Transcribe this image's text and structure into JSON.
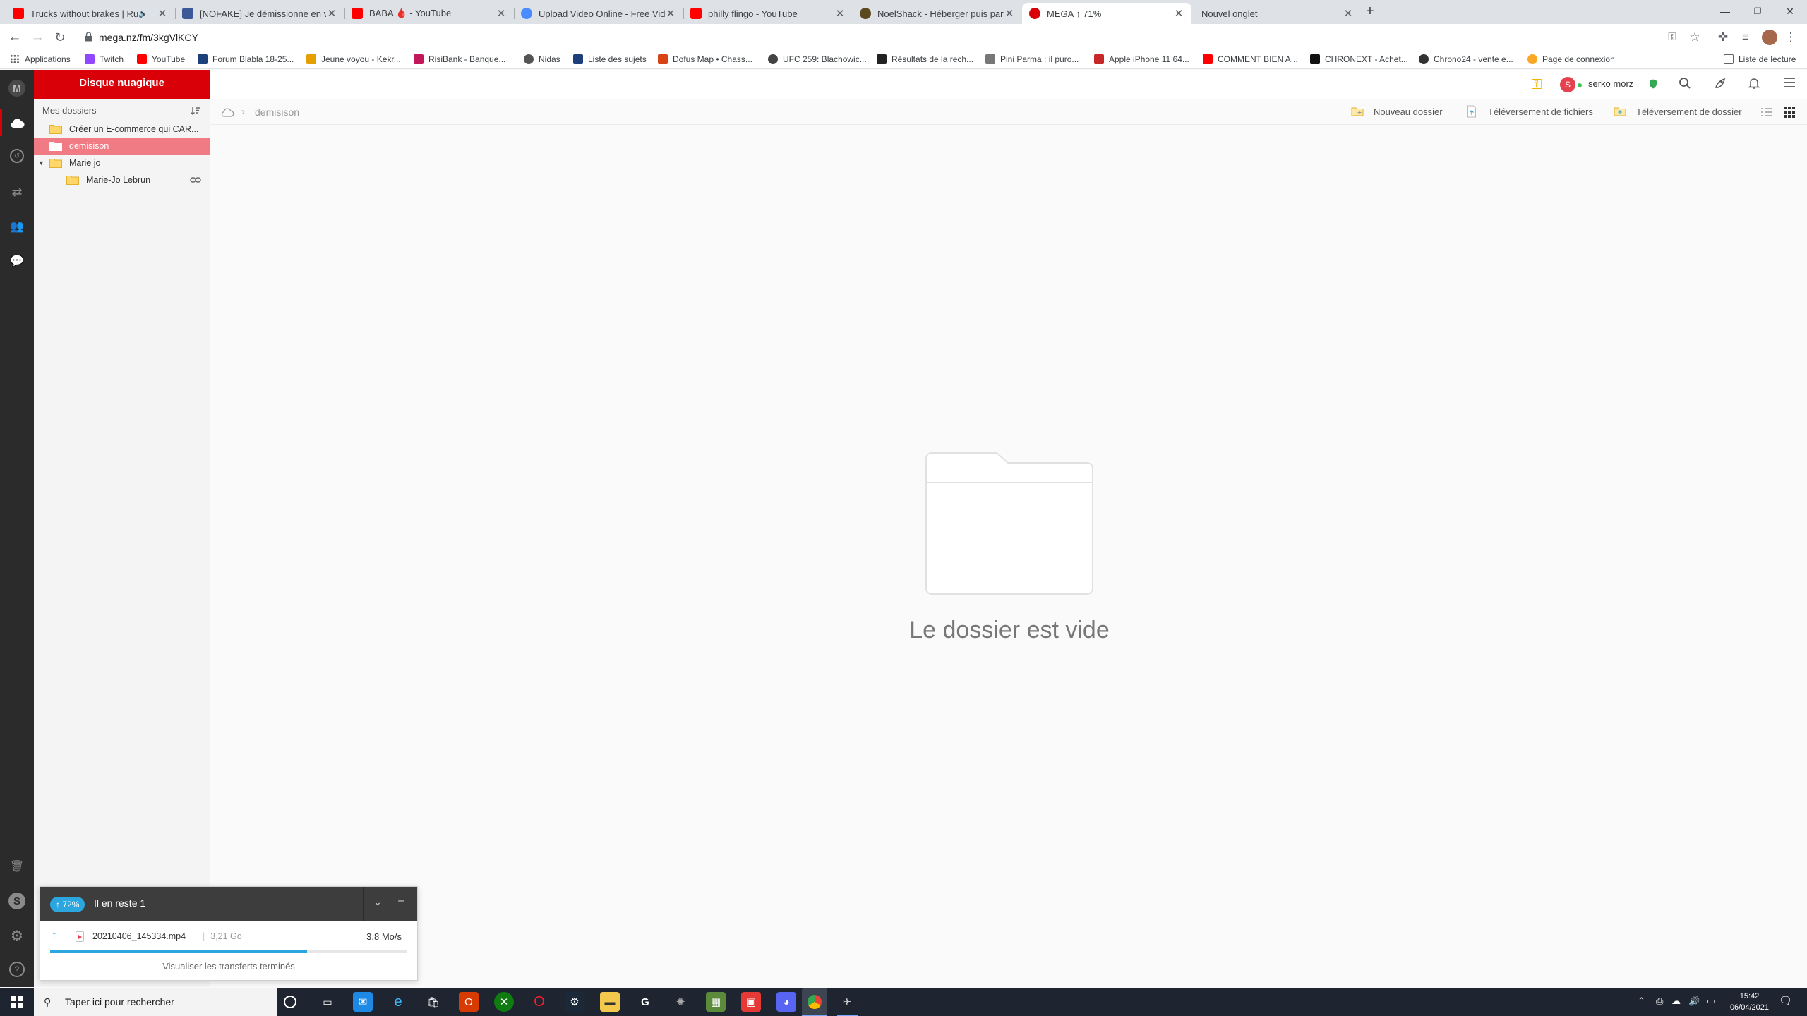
{
  "browser": {
    "tabs": [
      {
        "title": "Trucks without brakes | Runa",
        "fav": "#ff0000",
        "muted": true
      },
      {
        "title": "[NOFAKE] Je démissionne en voc",
        "fav": "#3b5998"
      },
      {
        "title": "BABA 🩸 - YouTube",
        "fav": "#ff0000"
      },
      {
        "title": "Upload Video Online - Free Video",
        "fav": "#4a8cff"
      },
      {
        "title": "philly flingo - YouTube",
        "fav": "#ff0000"
      },
      {
        "title": "NoelShack - Héberger puis parta",
        "fav": "#5b4a20"
      },
      {
        "title": "MEGA ↑ 71%",
        "fav": "#d90007"
      },
      {
        "title": "Nouvel onglet",
        "fav": ""
      }
    ],
    "url": "mega.nz/fm/3kgVlKCY",
    "bookmarks": [
      {
        "label": "Applications",
        "color": "#5f6368"
      },
      {
        "label": "Twitch",
        "color": "#9146ff"
      },
      {
        "label": "YouTube",
        "color": "#ff0000"
      },
      {
        "label": "Forum Blabla 18-25...",
        "color": "#1d3f7a"
      },
      {
        "label": "Jeune voyou - Kekr...",
        "color": "#e69f00"
      },
      {
        "label": "RisiBank - Banque...",
        "color": "#c2185b"
      },
      {
        "label": "Nidas",
        "color": "#555"
      },
      {
        "label": "Liste des sujets",
        "color": "#1d3f7a"
      },
      {
        "label": "Dofus Map • Chass...",
        "color": "#d84315"
      },
      {
        "label": "UFC 259: Blachowic...",
        "color": "#444"
      },
      {
        "label": "Résultats de la rech...",
        "color": "#222"
      },
      {
        "label": "Pini Parma : il puro...",
        "color": "#777"
      },
      {
        "label": "Apple iPhone 11 64...",
        "color": "#c62828"
      },
      {
        "label": "COMMENT BIEN A...",
        "color": "#ff0000"
      },
      {
        "label": "CHRONEXT - Achet...",
        "color": "#111"
      },
      {
        "label": "Chrono24 - vente e...",
        "color": "#333"
      },
      {
        "label": "Page de connexion",
        "color": "#f9a825"
      }
    ],
    "reading_list": "Liste de lecture"
  },
  "tree": {
    "header": "Disque nuagique",
    "section_title": "Mes dossiers",
    "items": [
      {
        "label": "Créer un E-commerce qui CAR...",
        "level": 0,
        "selected": false
      },
      {
        "label": "demisison",
        "level": 0,
        "selected": true
      },
      {
        "label": "Marie jo",
        "level": 0,
        "selected": false,
        "expanded": true
      },
      {
        "label": "Marie-Jo Lebrun",
        "level": 1,
        "selected": false,
        "linked": true
      }
    ]
  },
  "topbar": {
    "avatar_letter": "S",
    "username": "serko morz"
  },
  "actions": {
    "breadcrumb": "demisison",
    "new_folder": "Nouveau dossier",
    "upload_files": "Téléversement de fichiers",
    "upload_folder": "Téléversement de dossier"
  },
  "empty_state": {
    "text": "Le dossier est vide"
  },
  "transfer": {
    "percent_label": "72%",
    "remaining": "Il en reste 1",
    "file_name": "20210406_145334.mp4",
    "file_size": "3,21 Go",
    "speed": "3,8 Mo/s",
    "progress": 0.72,
    "footer": "Visualiser les transferts terminés"
  },
  "taskbar": {
    "search_placeholder": "Taper ici pour rechercher",
    "time": "15:42",
    "date": "06/04/2021"
  },
  "colors": {
    "mega_red": "#d90007",
    "selection": "#f07b85",
    "transfer_blue": "#2ba6de"
  }
}
